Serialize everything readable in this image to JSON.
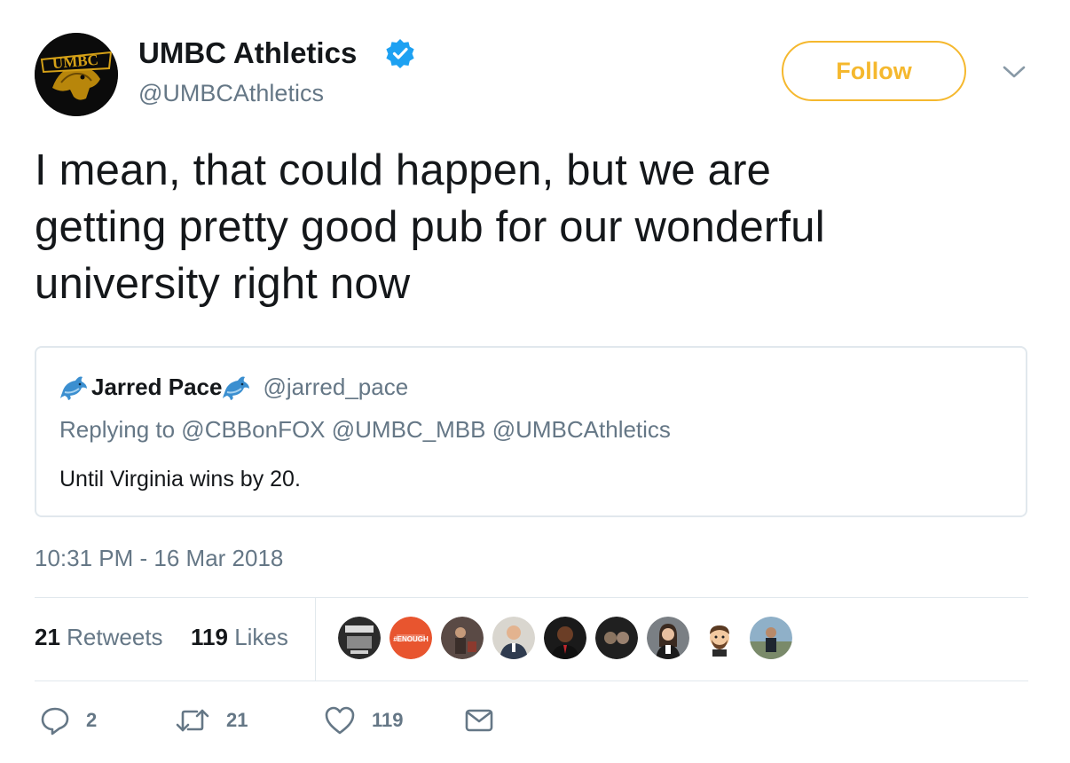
{
  "author": {
    "name": "UMBC Athletics",
    "handle": "@UMBCAthletics",
    "verified": true,
    "avatar_icon": "umbc-retriever-logo",
    "avatar_text": "UMBC"
  },
  "follow_button": {
    "label": "Follow",
    "color": "#f5b82e"
  },
  "menu_icon": "chevron-down-icon",
  "tweet": {
    "text_lines": [
      "I mean, that could happen, but we are",
      "getting pretty good pub for our wonderful",
      "university right now"
    ]
  },
  "quoted_tweet": {
    "name": "Jarred Pace",
    "name_emoji": "dolphin-icon",
    "handle": "@jarred_pace",
    "replying_to": "Replying to @CBBonFOX @UMBC_MBB @UMBCAthletics",
    "text": "Until Virginia wins by 20."
  },
  "timestamp": "10:31 PM - 16 Mar 2018",
  "stats": {
    "retweets_count": "21",
    "retweets_label": "Retweets",
    "likes_count": "119",
    "likes_label": "Likes"
  },
  "likers": [
    {
      "icon": "liker-avatar-1",
      "color": "#2b2b2b"
    },
    {
      "icon": "liker-avatar-enough",
      "color": "#e8552f",
      "text": "#ENOUGH"
    },
    {
      "icon": "liker-avatar-3",
      "color": "#5a4a45"
    },
    {
      "icon": "liker-avatar-4",
      "color": "#d9d6cf"
    },
    {
      "icon": "liker-avatar-5",
      "color": "#1a1a1a"
    },
    {
      "icon": "liker-avatar-6",
      "color": "#202020"
    },
    {
      "icon": "liker-avatar-7",
      "color": "#7a7f84"
    },
    {
      "icon": "liker-avatar-bitmoji",
      "color": "#ffffff"
    },
    {
      "icon": "liker-avatar-9",
      "color": "#8fb0c8"
    }
  ],
  "actions": {
    "reply_count": "2",
    "retweet_count": "21",
    "like_count": "119"
  },
  "colors": {
    "text_primary": "#14171a",
    "text_secondary": "#657786",
    "border": "#e1e8ed",
    "verified_blue": "#1da1f2",
    "accent_gold": "#f5b82e"
  }
}
